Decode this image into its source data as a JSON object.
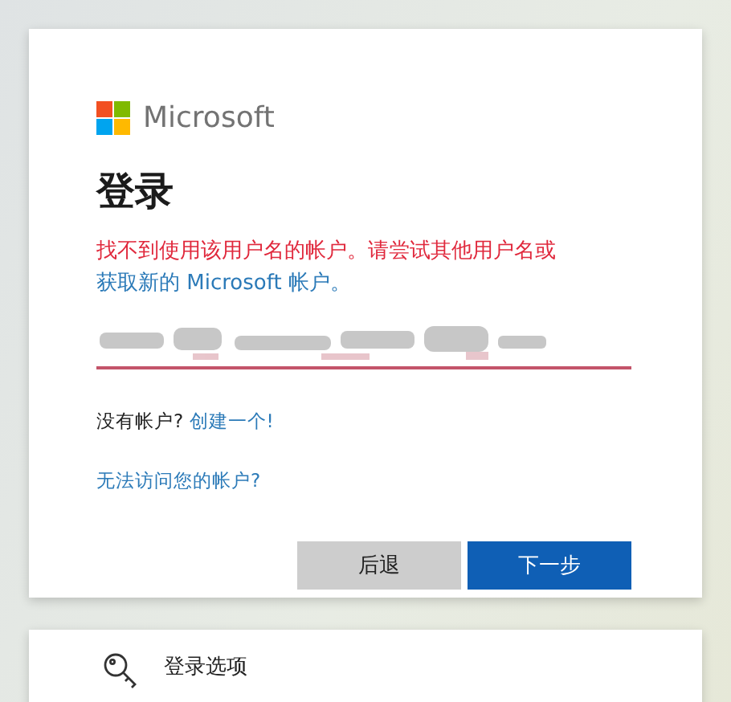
{
  "logo": {
    "text": "Microsoft"
  },
  "title": "登录",
  "error": {
    "message": "找不到使用该用户名的帐户。请尝试其他用户名或",
    "link": "获取新的 Microsoft 帐户。"
  },
  "username_field": {
    "invalid": true
  },
  "no_account": {
    "text": "没有帐户?",
    "link": "创建一个!"
  },
  "cant_access_link": "无法访问您的帐户?",
  "buttons": [
    {
      "label": "后退",
      "kind": "secondary"
    },
    {
      "label": "下一步",
      "kind": "primary"
    }
  ],
  "sign_in_options": {
    "label": "登录选项"
  }
}
